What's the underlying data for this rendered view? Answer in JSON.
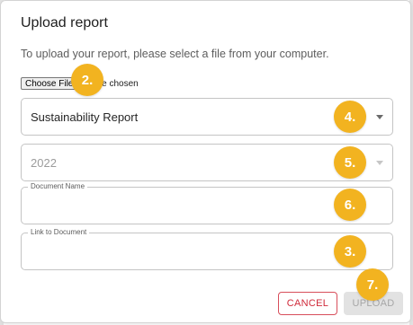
{
  "dialog": {
    "title": "Upload report",
    "instructions": "To upload your report, please select a file from your computer."
  },
  "file_input": {
    "button_label": "Choose File",
    "status_text": "No file chosen"
  },
  "report_type_select": {
    "value": "Sustainability Report"
  },
  "year_select": {
    "value": "2022",
    "disabled": true
  },
  "document_name_field": {
    "label": "Document Name",
    "value": ""
  },
  "document_link_field": {
    "label": "Link to Document",
    "value": ""
  },
  "actions": {
    "cancel_label": "CANCEL",
    "upload_label": "UPLOAD",
    "upload_disabled": true
  },
  "step_badges": {
    "choose_file": "2.",
    "report_type": "4.",
    "year": "5.",
    "document_name": "6.",
    "document_link": "3.",
    "upload": "7."
  },
  "colors": {
    "badge": "#f2b320",
    "cancel_accent": "#d02a3a",
    "disabled_button_bg": "#e2e2e2"
  }
}
